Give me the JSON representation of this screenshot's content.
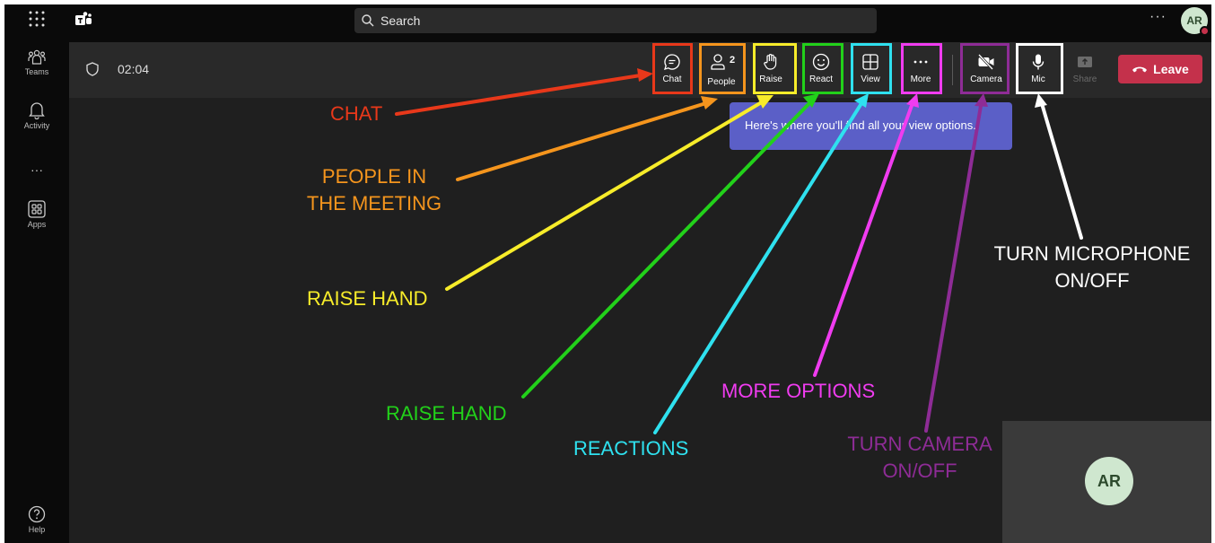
{
  "search": {
    "placeholder": "Search"
  },
  "avatar": {
    "initials": "AR"
  },
  "rail": [
    {
      "label": "Teams",
      "icon": "teams-icon"
    },
    {
      "label": "Activity",
      "icon": "bell-icon"
    },
    {
      "label": "",
      "icon": "more-icon"
    },
    {
      "label": "Apps",
      "icon": "apps-icon"
    },
    {
      "label": "Help",
      "icon": "help-icon"
    }
  ],
  "meeting": {
    "timer": "02:04",
    "controls": {
      "chat": {
        "label": "Chat",
        "icon": "chat-icon"
      },
      "people": {
        "label": "People",
        "icon": "people-icon",
        "count": "2"
      },
      "raise": {
        "label": "Raise",
        "icon": "raise-hand-icon"
      },
      "react": {
        "label": "React",
        "icon": "smiley-icon"
      },
      "view": {
        "label": "View",
        "icon": "view-layout-icon"
      },
      "more": {
        "label": "More",
        "icon": "more-icon"
      },
      "camera": {
        "label": "Camera",
        "icon": "camera-off-icon"
      },
      "mic": {
        "label": "Mic",
        "icon": "mic-icon"
      },
      "share": {
        "label": "Share",
        "icon": "share-icon"
      }
    },
    "leave_label": "Leave",
    "tooltip": "Here's where you'll find all your view options.",
    "self_initials": "AR"
  },
  "annotations": {
    "chat": "CHAT",
    "people": [
      "PEOPLE IN",
      "THE MEETING"
    ],
    "raise_yellow": "RAISE HAND",
    "raise_green": "RAISE HAND",
    "reactions": "REACTIONS",
    "more_options": "MORE OPTIONS",
    "camera": [
      "TURN CAMERA",
      "ON/OFF"
    ],
    "mic": [
      "TURN MICROPHONE",
      "ON/OFF"
    ]
  },
  "colors": {
    "chat": "#e8381a",
    "people": "#f5951d",
    "raise": "#f7ec2a",
    "react": "#22d11a",
    "view": "#2fe1ef",
    "more": "#f03cf0",
    "camera": "#8e2c96",
    "mic": "#ffffff",
    "leave": "#c4314b",
    "tooltip": "#5b5fc7"
  }
}
